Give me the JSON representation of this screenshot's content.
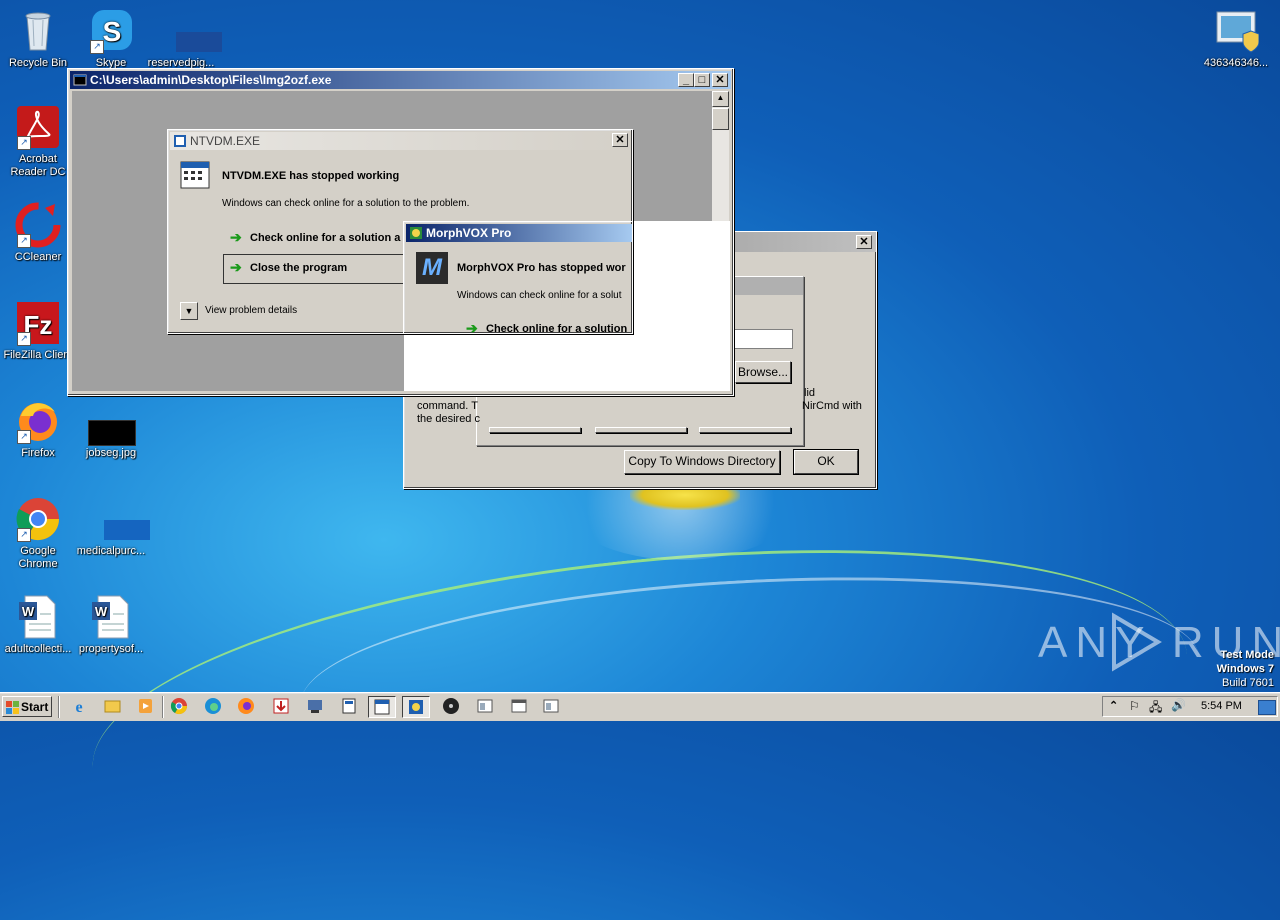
{
  "desktop": {
    "icons": [
      {
        "label": "Recycle Bin"
      },
      {
        "label": "Skype"
      },
      {
        "label": "reservedpig..."
      },
      {
        "label": "Acrobat Reader DC"
      },
      {
        "label": "CCleaner"
      },
      {
        "label": "FileZilla Client"
      },
      {
        "label": "Firefox"
      },
      {
        "label": "jobseg.jpg"
      },
      {
        "label": "Google Chrome"
      },
      {
        "label": "medicalpurc..."
      },
      {
        "label": "adultcollecti..."
      },
      {
        "label": "propertysof..."
      },
      {
        "label": "436346346..."
      }
    ],
    "watermark": "ANY RUN",
    "testmode": [
      "Test Mode",
      "Windows 7",
      "Build 7601"
    ]
  },
  "console_window": {
    "title": "C:\\Users\\admin\\Desktop\\Files\\Img2ozf.exe"
  },
  "ntvdm_dialog": {
    "title": "NTVDM.EXE",
    "heading": "NTVDM.EXE has stopped working",
    "message": "Windows can check online for a solution to the problem.",
    "option_check": "Check online for a solution a",
    "option_close": "Close the program",
    "details": "View problem details"
  },
  "morphvox_dialog": {
    "title": "MorphVOX Pro",
    "heading": "MorphVOX Pro has stopped wor",
    "message": "Windows can check online for a solut",
    "option_check": "Check online for a solution"
  },
  "nircmd_dialog": {
    "text_line1": "command. T",
    "text_line2": "the desired c",
    "text_right1": "lid",
    "text_right2": "NirCmd with",
    "browse": "Browse...",
    "copy_button": "Copy To Windows Directory",
    "ok_button": "OK"
  },
  "taskbar": {
    "start": "Start",
    "clock": "5:54 PM"
  }
}
